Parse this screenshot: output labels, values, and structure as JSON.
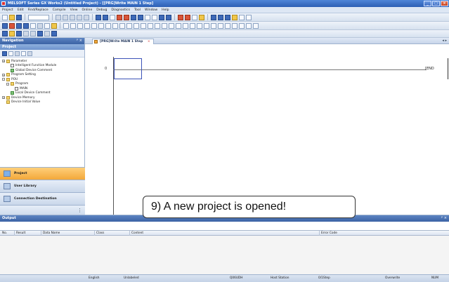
{
  "window": {
    "title": "MELSOFT Series GX Works2 (Untitled Project) - [[PRG]Write MAIN 1 Step]",
    "controls": [
      "_",
      "□",
      "×"
    ]
  },
  "menu": [
    "Project",
    "Edit",
    "Find/Replace",
    "Compile",
    "View",
    "Online",
    "Debug",
    "Diagnostics",
    "Tool",
    "Window",
    "Help"
  ],
  "navigation": {
    "title": "Navigation",
    "pin": "ᵖ ×",
    "section": "Project",
    "tree": [
      {
        "label": "Parameter",
        "level": 0,
        "expander": "+",
        "icon": "f"
      },
      {
        "label": "Intelligent Function Module",
        "level": 1,
        "expander": "",
        "icon": "p"
      },
      {
        "label": "Global Device Comment",
        "level": 1,
        "expander": "",
        "icon": "g"
      },
      {
        "label": "Program Setting",
        "level": 0,
        "expander": "+",
        "icon": "f"
      },
      {
        "label": "POU",
        "level": 0,
        "expander": "-",
        "icon": "f"
      },
      {
        "label": "Program",
        "level": 1,
        "expander": "-",
        "icon": "f"
      },
      {
        "label": "MAIN",
        "level": 2,
        "expander": "",
        "icon": "p"
      },
      {
        "label": "Local Device Comment",
        "level": 1,
        "expander": "",
        "icon": "g"
      },
      {
        "label": "Device Memory",
        "level": 0,
        "expander": "+",
        "icon": "f"
      },
      {
        "label": "Device Initial Value",
        "level": 0,
        "expander": "",
        "icon": "f"
      }
    ],
    "tabs": [
      {
        "label": "Project",
        "active": true
      },
      {
        "label": "User Library",
        "active": false
      },
      {
        "label": "Connection Destination",
        "active": false
      }
    ]
  },
  "editor": {
    "tab_label": "[PRG]Write MAIN 1 Step",
    "tab_close": "×",
    "tab_nav": "◂ ▸",
    "step_number": "0",
    "end_label": "[END"
  },
  "callout": "9) A new project is opened!",
  "output": {
    "title": "Output",
    "pin": "ᵖ ×",
    "columns": [
      "No.",
      "Result",
      "Data Name",
      "Class",
      "Content",
      "Error Code"
    ]
  },
  "statusbar": [
    "English",
    "Unlabeled",
    "Q06UDH",
    "Host Station",
    "0/1Step",
    "Overwrite",
    "NUM"
  ]
}
